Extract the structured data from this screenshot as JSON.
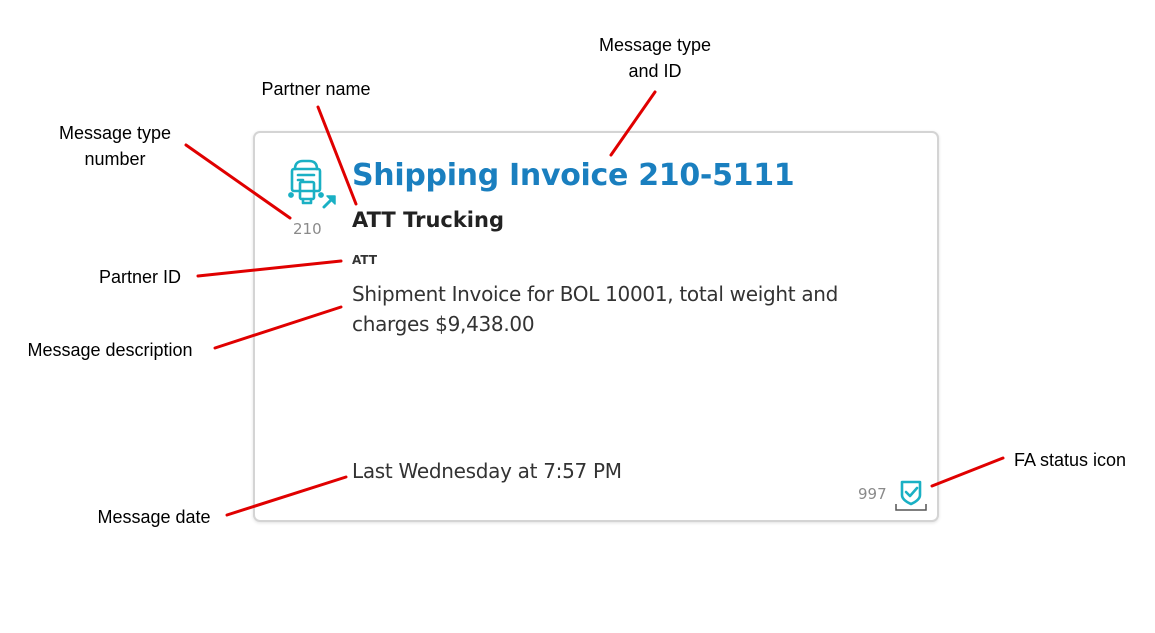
{
  "callouts": {
    "message_type_number_line1": "Message type",
    "message_type_number_line2": "number",
    "partner_name": "Partner name",
    "message_type_id_line1": "Message type",
    "message_type_id_line2": "and ID",
    "partner_id": "Partner ID",
    "message_description": "Message description",
    "message_date": "Message date",
    "fa_status_icon": "FA status icon"
  },
  "card": {
    "type_icon": "shipping-invoice-icon",
    "type_number": "210",
    "title": "Shipping Invoice 210-5111",
    "partner_name": "ATT Trucking",
    "partner_id": "ATT",
    "description": "Shipment Invoice for BOL 10001, total weight and charges $9,438.00",
    "date": "Last Wednesday at 7:57 PM",
    "fa_number": "997",
    "fa_icon": "fa-status-check-icon"
  },
  "colors": {
    "title": "#1a7fbf",
    "icon_teal": "#1ab0c4",
    "leader_line": "#e00000",
    "muted_text": "#8a8a8a"
  }
}
